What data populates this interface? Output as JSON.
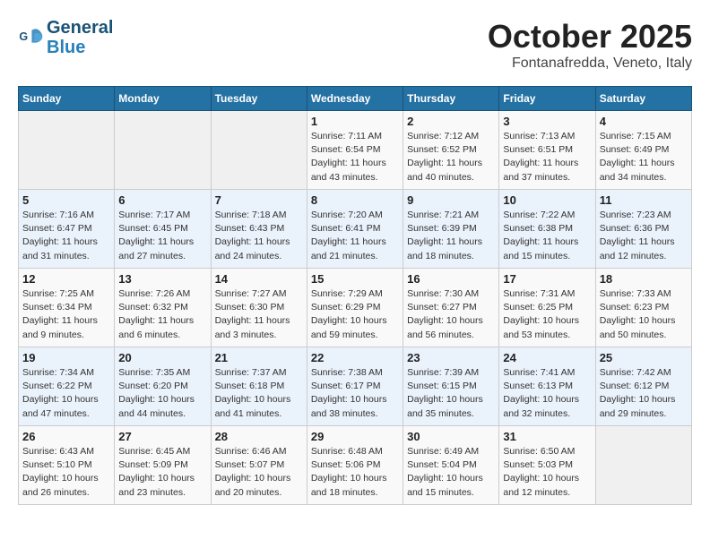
{
  "header": {
    "logo_line1": "General",
    "logo_line2": "Blue",
    "month": "October 2025",
    "location": "Fontanafredda, Veneto, Italy"
  },
  "weekdays": [
    "Sunday",
    "Monday",
    "Tuesday",
    "Wednesday",
    "Thursday",
    "Friday",
    "Saturday"
  ],
  "weeks": [
    [
      {
        "day": "",
        "info": ""
      },
      {
        "day": "",
        "info": ""
      },
      {
        "day": "",
        "info": ""
      },
      {
        "day": "1",
        "info": "Sunrise: 7:11 AM\nSunset: 6:54 PM\nDaylight: 11 hours\nand 43 minutes."
      },
      {
        "day": "2",
        "info": "Sunrise: 7:12 AM\nSunset: 6:52 PM\nDaylight: 11 hours\nand 40 minutes."
      },
      {
        "day": "3",
        "info": "Sunrise: 7:13 AM\nSunset: 6:51 PM\nDaylight: 11 hours\nand 37 minutes."
      },
      {
        "day": "4",
        "info": "Sunrise: 7:15 AM\nSunset: 6:49 PM\nDaylight: 11 hours\nand 34 minutes."
      }
    ],
    [
      {
        "day": "5",
        "info": "Sunrise: 7:16 AM\nSunset: 6:47 PM\nDaylight: 11 hours\nand 31 minutes."
      },
      {
        "day": "6",
        "info": "Sunrise: 7:17 AM\nSunset: 6:45 PM\nDaylight: 11 hours\nand 27 minutes."
      },
      {
        "day": "7",
        "info": "Sunrise: 7:18 AM\nSunset: 6:43 PM\nDaylight: 11 hours\nand 24 minutes."
      },
      {
        "day": "8",
        "info": "Sunrise: 7:20 AM\nSunset: 6:41 PM\nDaylight: 11 hours\nand 21 minutes."
      },
      {
        "day": "9",
        "info": "Sunrise: 7:21 AM\nSunset: 6:39 PM\nDaylight: 11 hours\nand 18 minutes."
      },
      {
        "day": "10",
        "info": "Sunrise: 7:22 AM\nSunset: 6:38 PM\nDaylight: 11 hours\nand 15 minutes."
      },
      {
        "day": "11",
        "info": "Sunrise: 7:23 AM\nSunset: 6:36 PM\nDaylight: 11 hours\nand 12 minutes."
      }
    ],
    [
      {
        "day": "12",
        "info": "Sunrise: 7:25 AM\nSunset: 6:34 PM\nDaylight: 11 hours\nand 9 minutes."
      },
      {
        "day": "13",
        "info": "Sunrise: 7:26 AM\nSunset: 6:32 PM\nDaylight: 11 hours\nand 6 minutes."
      },
      {
        "day": "14",
        "info": "Sunrise: 7:27 AM\nSunset: 6:30 PM\nDaylight: 11 hours\nand 3 minutes."
      },
      {
        "day": "15",
        "info": "Sunrise: 7:29 AM\nSunset: 6:29 PM\nDaylight: 10 hours\nand 59 minutes."
      },
      {
        "day": "16",
        "info": "Sunrise: 7:30 AM\nSunset: 6:27 PM\nDaylight: 10 hours\nand 56 minutes."
      },
      {
        "day": "17",
        "info": "Sunrise: 7:31 AM\nSunset: 6:25 PM\nDaylight: 10 hours\nand 53 minutes."
      },
      {
        "day": "18",
        "info": "Sunrise: 7:33 AM\nSunset: 6:23 PM\nDaylight: 10 hours\nand 50 minutes."
      }
    ],
    [
      {
        "day": "19",
        "info": "Sunrise: 7:34 AM\nSunset: 6:22 PM\nDaylight: 10 hours\nand 47 minutes."
      },
      {
        "day": "20",
        "info": "Sunrise: 7:35 AM\nSunset: 6:20 PM\nDaylight: 10 hours\nand 44 minutes."
      },
      {
        "day": "21",
        "info": "Sunrise: 7:37 AM\nSunset: 6:18 PM\nDaylight: 10 hours\nand 41 minutes."
      },
      {
        "day": "22",
        "info": "Sunrise: 7:38 AM\nSunset: 6:17 PM\nDaylight: 10 hours\nand 38 minutes."
      },
      {
        "day": "23",
        "info": "Sunrise: 7:39 AM\nSunset: 6:15 PM\nDaylight: 10 hours\nand 35 minutes."
      },
      {
        "day": "24",
        "info": "Sunrise: 7:41 AM\nSunset: 6:13 PM\nDaylight: 10 hours\nand 32 minutes."
      },
      {
        "day": "25",
        "info": "Sunrise: 7:42 AM\nSunset: 6:12 PM\nDaylight: 10 hours\nand 29 minutes."
      }
    ],
    [
      {
        "day": "26",
        "info": "Sunrise: 6:43 AM\nSunset: 5:10 PM\nDaylight: 10 hours\nand 26 minutes."
      },
      {
        "day": "27",
        "info": "Sunrise: 6:45 AM\nSunset: 5:09 PM\nDaylight: 10 hours\nand 23 minutes."
      },
      {
        "day": "28",
        "info": "Sunrise: 6:46 AM\nSunset: 5:07 PM\nDaylight: 10 hours\nand 20 minutes."
      },
      {
        "day": "29",
        "info": "Sunrise: 6:48 AM\nSunset: 5:06 PM\nDaylight: 10 hours\nand 18 minutes."
      },
      {
        "day": "30",
        "info": "Sunrise: 6:49 AM\nSunset: 5:04 PM\nDaylight: 10 hours\nand 15 minutes."
      },
      {
        "day": "31",
        "info": "Sunrise: 6:50 AM\nSunset: 5:03 PM\nDaylight: 10 hours\nand 12 minutes."
      },
      {
        "day": "",
        "info": ""
      }
    ]
  ]
}
